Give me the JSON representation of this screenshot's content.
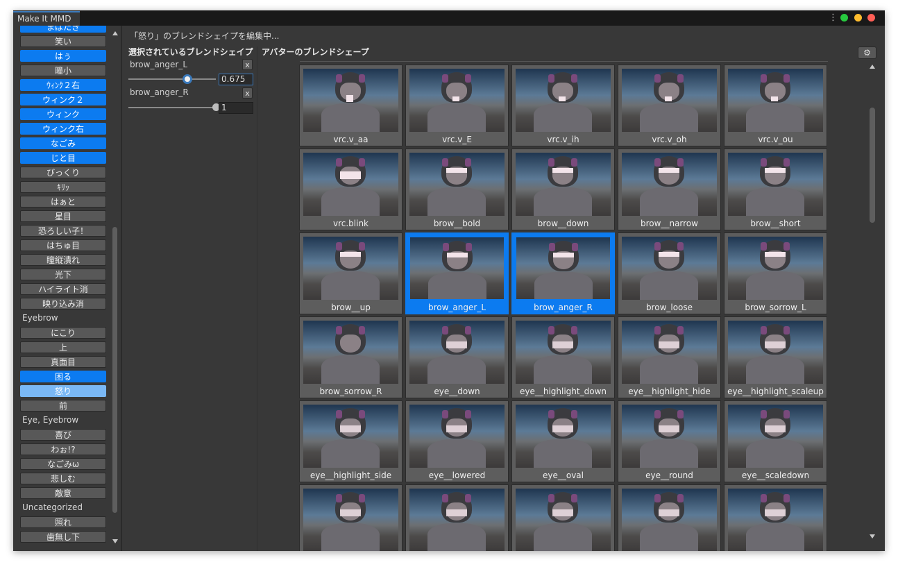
{
  "window": {
    "title": "Make It MMD"
  },
  "status": {
    "editing": "「怒り」のブレンドシェイプを編集中..."
  },
  "left_list": [
    {
      "type": "button",
      "label": "まばたき",
      "selected": true
    },
    {
      "type": "button",
      "label": "笑い",
      "selected": false
    },
    {
      "type": "button",
      "label": "はぅ",
      "selected": true
    },
    {
      "type": "button",
      "label": "瞳小",
      "selected": false
    },
    {
      "type": "button",
      "label": "ｳｨﾝｸ２右",
      "selected": true
    },
    {
      "type": "button",
      "label": "ウィンク２",
      "selected": true
    },
    {
      "type": "button",
      "label": "ウィンク",
      "selected": true
    },
    {
      "type": "button",
      "label": "ウィンク右",
      "selected": true
    },
    {
      "type": "button",
      "label": "なごみ",
      "selected": true
    },
    {
      "type": "button",
      "label": "じと目",
      "selected": true
    },
    {
      "type": "button",
      "label": "びっくり",
      "selected": false
    },
    {
      "type": "button",
      "label": "ｷﾘｯ",
      "selected": false
    },
    {
      "type": "button",
      "label": "はぁと",
      "selected": false
    },
    {
      "type": "button",
      "label": "星目",
      "selected": false
    },
    {
      "type": "button",
      "label": "恐ろしい子！",
      "selected": false
    },
    {
      "type": "button",
      "label": "はちゅ目",
      "selected": false
    },
    {
      "type": "button",
      "label": "瞳縦潰れ",
      "selected": false
    },
    {
      "type": "button",
      "label": "光下",
      "selected": false
    },
    {
      "type": "button",
      "label": "ハイライト消",
      "selected": false
    },
    {
      "type": "button",
      "label": "映り込み消",
      "selected": false
    },
    {
      "type": "category",
      "label": "Eyebrow"
    },
    {
      "type": "button",
      "label": "にこり",
      "selected": false
    },
    {
      "type": "button",
      "label": "上",
      "selected": false
    },
    {
      "type": "button",
      "label": "真面目",
      "selected": false
    },
    {
      "type": "button",
      "label": "困る",
      "selected": true
    },
    {
      "type": "button",
      "label": "怒り",
      "selected": true,
      "current": true
    },
    {
      "type": "button",
      "label": "前",
      "selected": false
    },
    {
      "type": "category",
      "label": "Eye, Eyebrow"
    },
    {
      "type": "button",
      "label": "喜び",
      "selected": false
    },
    {
      "type": "button",
      "label": "わぉ!?",
      "selected": false
    },
    {
      "type": "button",
      "label": "なごみω",
      "selected": false
    },
    {
      "type": "button",
      "label": "悲しむ",
      "selected": false
    },
    {
      "type": "button",
      "label": "敵意",
      "selected": false
    },
    {
      "type": "category",
      "label": "Uncategorized"
    },
    {
      "type": "button",
      "label": "照れ",
      "selected": false
    },
    {
      "type": "button",
      "label": "歯無し下",
      "selected": false
    }
  ],
  "selected_panel": {
    "header": "選択されているブレンドシェイプ",
    "items": [
      {
        "name": "brow_anger_L",
        "value": "0.675",
        "slider": 0.675,
        "remove_label": "x"
      },
      {
        "name": "brow_anger_R",
        "value": "1",
        "slider": 1.0,
        "remove_label": "x"
      }
    ]
  },
  "avatar_panel": {
    "header": "アバターのブレンドシェープ",
    "settings_icon": "gear-icon",
    "items": [
      {
        "label": "vrc.v_aa",
        "expr": "mouth-open",
        "selected": false
      },
      {
        "label": "vrc.v_E",
        "expr": "mouth-wide",
        "selected": false
      },
      {
        "label": "vrc.v_ih",
        "expr": "mouth-small",
        "selected": false
      },
      {
        "label": "vrc.v_oh",
        "expr": "mouth-round",
        "selected": false
      },
      {
        "label": "vrc.v_ou",
        "expr": "mouth-round",
        "selected": false
      },
      {
        "label": "vrc.blink",
        "expr": "eyes-closed",
        "selected": false
      },
      {
        "label": "brow__bold",
        "expr": "brow",
        "selected": false
      },
      {
        "label": "brow__down",
        "expr": "brow",
        "selected": false
      },
      {
        "label": "brow__narrow",
        "expr": "brow",
        "selected": false
      },
      {
        "label": "brow__short",
        "expr": "brow",
        "selected": false
      },
      {
        "label": "brow__up",
        "expr": "brow",
        "selected": false
      },
      {
        "label": "brow_anger_L",
        "expr": "brow",
        "selected": true
      },
      {
        "label": "brow_anger_R",
        "expr": "brow",
        "selected": true
      },
      {
        "label": "brow_loose",
        "expr": "brow",
        "selected": false
      },
      {
        "label": "brow_sorrow_L",
        "expr": "brow",
        "selected": false
      },
      {
        "label": "brow_sorrow_R",
        "expr": "none",
        "selected": false
      },
      {
        "label": "eye__down",
        "expr": "eye",
        "selected": false
      },
      {
        "label": "eye__highlight_down",
        "expr": "eye",
        "selected": false
      },
      {
        "label": "eye__highlight_hide",
        "expr": "eye",
        "selected": false
      },
      {
        "label": "eye__highlight_scaleup",
        "expr": "eye",
        "selected": false
      },
      {
        "label": "eye__highlight_side",
        "expr": "eye",
        "selected": false
      },
      {
        "label": "eye__lowered",
        "expr": "eye",
        "selected": false
      },
      {
        "label": "eye__oval",
        "expr": "eye",
        "selected": false
      },
      {
        "label": "eye__round",
        "expr": "eye",
        "selected": false
      },
      {
        "label": "eye__scaledown",
        "expr": "eye",
        "selected": false
      },
      {
        "label": "",
        "expr": "eye",
        "selected": false
      },
      {
        "label": "",
        "expr": "eye",
        "selected": false
      },
      {
        "label": "",
        "expr": "eye",
        "selected": false
      },
      {
        "label": "",
        "expr": "eye",
        "selected": false
      },
      {
        "label": "",
        "expr": "eye",
        "selected": false
      }
    ]
  },
  "colors": {
    "accent": "#0c7bf0",
    "accent_light": "#7ab8f5",
    "panel": "#383838",
    "button": "#585858"
  }
}
